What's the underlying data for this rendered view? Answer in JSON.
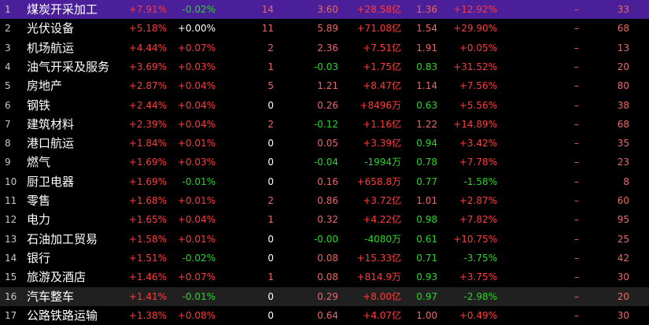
{
  "colors": {
    "up": "#ff3b3b",
    "down": "#2bd42b",
    "flat": "#ffffff",
    "neutral": "#e6d200",
    "selected_bg": "#4b1e9a",
    "hover_bg": "#202020"
  },
  "rows": [
    {
      "idx": "1",
      "name": "煤炭开采加工",
      "chg": "+7.91%",
      "speed": "-0.02%",
      "c3": "14",
      "c4": "3.60",
      "c5": "+28.58亿",
      "c6": "1.36",
      "c7": "+12.92%",
      "c8": "–",
      "c9": "33"
    },
    {
      "idx": "2",
      "name": "光伏设备",
      "chg": "+5.18%",
      "speed": "+0.00%",
      "c3": "11",
      "c4": "5.89",
      "c5": "+71.08亿",
      "c6": "1.54",
      "c7": "+29.90%",
      "c8": "–",
      "c9": "68"
    },
    {
      "idx": "3",
      "name": "机场航运",
      "chg": "+4.44%",
      "speed": "+0.07%",
      "c3": "2",
      "c4": "2.36",
      "c5": "+7.51亿",
      "c6": "1.91",
      "c7": "+0.05%",
      "c8": "–",
      "c9": "13"
    },
    {
      "idx": "4",
      "name": "油气开采及服务",
      "chg": "+3.69%",
      "speed": "+0.03%",
      "c3": "1",
      "c4": "-0.03",
      "c5": "+1.75亿",
      "c6": "0.83",
      "c7": "+31.52%",
      "c8": "–",
      "c9": "20"
    },
    {
      "idx": "5",
      "name": "房地产",
      "chg": "+2.87%",
      "speed": "+0.04%",
      "c3": "5",
      "c4": "1.21",
      "c5": "+8.47亿",
      "c6": "1.14",
      "c7": "+7.56%",
      "c8": "–",
      "c9": "80"
    },
    {
      "idx": "6",
      "name": "钢铁",
      "chg": "+2.44%",
      "speed": "+0.04%",
      "c3": "0",
      "c4": "0.26",
      "c5": "+8496万",
      "c6": "0.63",
      "c7": "+5.56%",
      "c8": "–",
      "c9": "38"
    },
    {
      "idx": "7",
      "name": "建筑材料",
      "chg": "+2.39%",
      "speed": "+0.04%",
      "c3": "2",
      "c4": "-0.12",
      "c5": "+1.16亿",
      "c6": "1.22",
      "c7": "+14.89%",
      "c8": "–",
      "c9": "68"
    },
    {
      "idx": "8",
      "name": "港口航运",
      "chg": "+1.84%",
      "speed": "+0.01%",
      "c3": "0",
      "c4": "0.05",
      "c5": "+3.39亿",
      "c6": "0.94",
      "c7": "+3.42%",
      "c8": "–",
      "c9": "35"
    },
    {
      "idx": "9",
      "name": "燃气",
      "chg": "+1.69%",
      "speed": "+0.03%",
      "c3": "0",
      "c4": "-0.04",
      "c5": "-1994万",
      "c6": "0.78",
      "c7": "+7.78%",
      "c8": "–",
      "c9": "23"
    },
    {
      "idx": "10",
      "name": "厨卫电器",
      "chg": "+1.69%",
      "speed": "-0.01%",
      "c3": "0",
      "c4": "0.16",
      "c5": "+658.8万",
      "c6": "0.77",
      "c7": "-1.58%",
      "c8": "–",
      "c9": "8"
    },
    {
      "idx": "11",
      "name": "零售",
      "chg": "+1.68%",
      "speed": "+0.01%",
      "c3": "2",
      "c4": "0.86",
      "c5": "+3.72亿",
      "c6": "1.01",
      "c7": "+2.87%",
      "c8": "–",
      "c9": "60"
    },
    {
      "idx": "12",
      "name": "电力",
      "chg": "+1.65%",
      "speed": "+0.04%",
      "c3": "1",
      "c4": "0.32",
      "c5": "+4.22亿",
      "c6": "0.98",
      "c7": "+7.82%",
      "c8": "–",
      "c9": "95"
    },
    {
      "idx": "13",
      "name": "石油加工贸易",
      "chg": "+1.58%",
      "speed": "+0.01%",
      "c3": "0",
      "c4": "-0.00",
      "c5": "-4080万",
      "c6": "0.61",
      "c7": "+10.75%",
      "c8": "–",
      "c9": "25"
    },
    {
      "idx": "14",
      "name": "银行",
      "chg": "+1.51%",
      "speed": "-0.02%",
      "c3": "0",
      "c4": "0.08",
      "c5": "+15.33亿",
      "c6": "0.71",
      "c7": "-3.75%",
      "c8": "–",
      "c9": "42"
    },
    {
      "idx": "15",
      "name": "旅游及酒店",
      "chg": "+1.46%",
      "speed": "+0.07%",
      "c3": "1",
      "c4": "0.08",
      "c5": "+814.9万",
      "c6": "0.93",
      "c7": "+3.75%",
      "c8": "–",
      "c9": "30"
    },
    {
      "idx": "16",
      "name": "汽车整车",
      "chg": "+1.41%",
      "speed": "-0.01%",
      "c3": "0",
      "c4": "0.29",
      "c5": "+8.00亿",
      "c6": "0.97",
      "c7": "-2.98%",
      "c8": "–",
      "c9": "20"
    },
    {
      "idx": "17",
      "name": "公路铁路运输",
      "chg": "+1.38%",
      "speed": "+0.08%",
      "c3": "0",
      "c4": "0.64",
      "c5": "+4.07亿",
      "c6": "1.00",
      "c7": "+0.49%",
      "c8": "–",
      "c9": "30"
    }
  ]
}
